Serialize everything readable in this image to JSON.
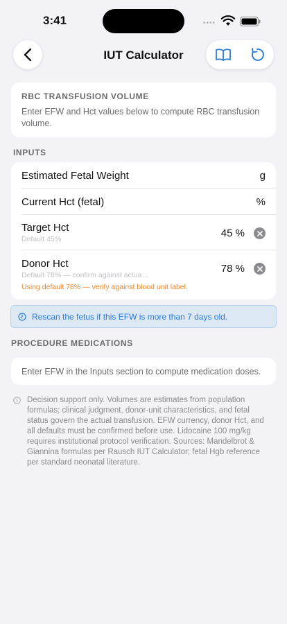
{
  "status": {
    "time": "3:41",
    "dots": "••••"
  },
  "nav": {
    "title": "IUT Calculator"
  },
  "info": {
    "heading": "RBC TRANSFUSION VOLUME",
    "description": "Enter EFW and Hct values below to compute RBC transfusion volume."
  },
  "inputs": {
    "section_label": "INPUTS",
    "efw": {
      "label": "Estimated Fetal Weight",
      "unit": "g"
    },
    "current_hct": {
      "label": "Current Hct (fetal)",
      "unit": "%"
    },
    "target_hct": {
      "label": "Target Hct",
      "sub": "Default 45%",
      "value": "45 %"
    },
    "donor_hct": {
      "label": "Donor Hct",
      "sub": "Default 78% — confirm against actua…",
      "value": "78 %",
      "warning": "Using default 78% — verify against blood unit label."
    }
  },
  "alert": {
    "text": "Rescan the fetus if this EFW is more than 7 days old."
  },
  "medications": {
    "section_label": "PROCEDURE MEDICATIONS",
    "placeholder": "Enter EFW in the Inputs section to compute medication doses."
  },
  "disclaimer": {
    "text": "Decision support only. Volumes are estimates from population formulas; clinical judgment, donor-unit characteristics, and fetal status govern the actual transfusion. EFW currency, donor Hct, and all defaults must be confirmed before use. Lidocaine 100 mg/kg requires institutional protocol verification. Sources: Mandelbrot & Giannina formulas per Rausch IUT Calculator; fetal Hgb reference per standard neonatal literature."
  },
  "colors": {
    "accent": "#2a7bd6",
    "warning": "#e8862c",
    "background": "#f2f2f7"
  },
  "icons": [
    "chevron-left-icon",
    "book-icon",
    "reset-icon",
    "clear-icon",
    "clock-icon",
    "info-icon",
    "wifi-icon",
    "battery-icon"
  ]
}
